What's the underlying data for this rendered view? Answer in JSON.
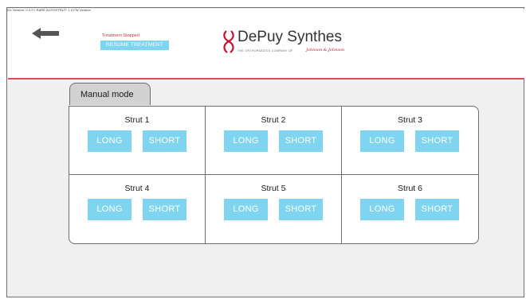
{
  "window": {
    "title": "DV Version: 0.0.0 / RARE AUTOSTRUT: 1.0 FW Version"
  },
  "header": {
    "back_icon": "arrow-left-icon",
    "status_text": "Treatment Stopped",
    "resume_label": "RESUME TREATMENT",
    "brand_name": "DePuy Synthes",
    "brand_tagline": "THE ORTHOPAEDICS COMPANY OF",
    "brand_parent": "Johnson & Johnson"
  },
  "mode": {
    "tab_label": "Manual mode"
  },
  "struts": [
    {
      "title": "Strut 1",
      "long_label": "LONG",
      "short_label": "SHORT"
    },
    {
      "title": "Strut 2",
      "long_label": "LONG",
      "short_label": "SHORT"
    },
    {
      "title": "Strut 3",
      "long_label": "LONG",
      "short_label": "SHORT"
    },
    {
      "title": "Strut 4",
      "long_label": "LONG",
      "short_label": "SHORT"
    },
    {
      "title": "Strut 5",
      "long_label": "LONG",
      "short_label": "SHORT"
    },
    {
      "title": "Strut 6",
      "long_label": "LONG",
      "short_label": "SHORT"
    }
  ],
  "colors": {
    "accent_button": "#7fd4ef",
    "header_rule": "#d94f5c",
    "status_red": "#d4303e",
    "background": "#f0f0f0"
  }
}
